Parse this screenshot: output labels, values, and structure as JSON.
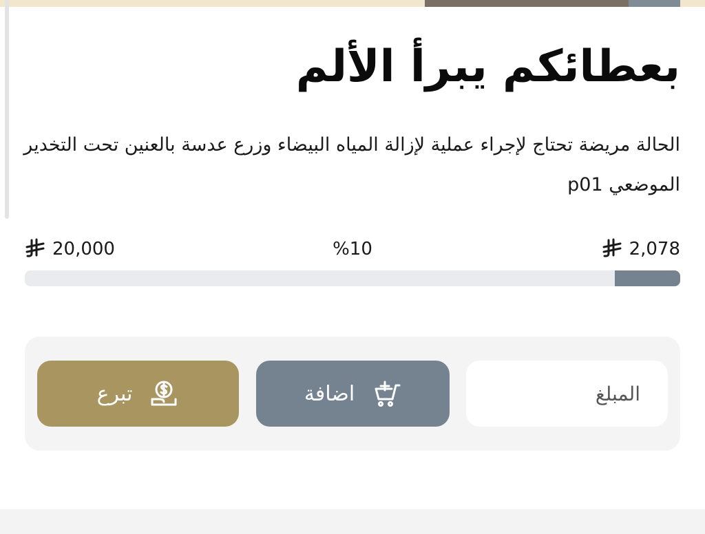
{
  "campaign": {
    "title": "بعطائكم يبرأ الألم",
    "description": "الحالة مريضة تحتاج لإجراء عملية لإزالة المياه البيضاء وزرع عدسة بالعنين تحت التخدير الموضعي p01"
  },
  "progress": {
    "raised": "2,078",
    "goal": "20,000",
    "percent_label": "%10",
    "percent_value": 10,
    "currency_icon": "saudi-riyal-icon"
  },
  "donation": {
    "amount_placeholder": "المبلغ",
    "add_label": "اضافة",
    "add_icon": "cart-add-icon",
    "donate_label": "تبرع",
    "donate_icon": "coin-hand-icon"
  },
  "colors": {
    "progress_fill": "#74838f",
    "progress_track": "#e9ebee",
    "add_button": "#74838f",
    "donate_button": "#a99560"
  }
}
